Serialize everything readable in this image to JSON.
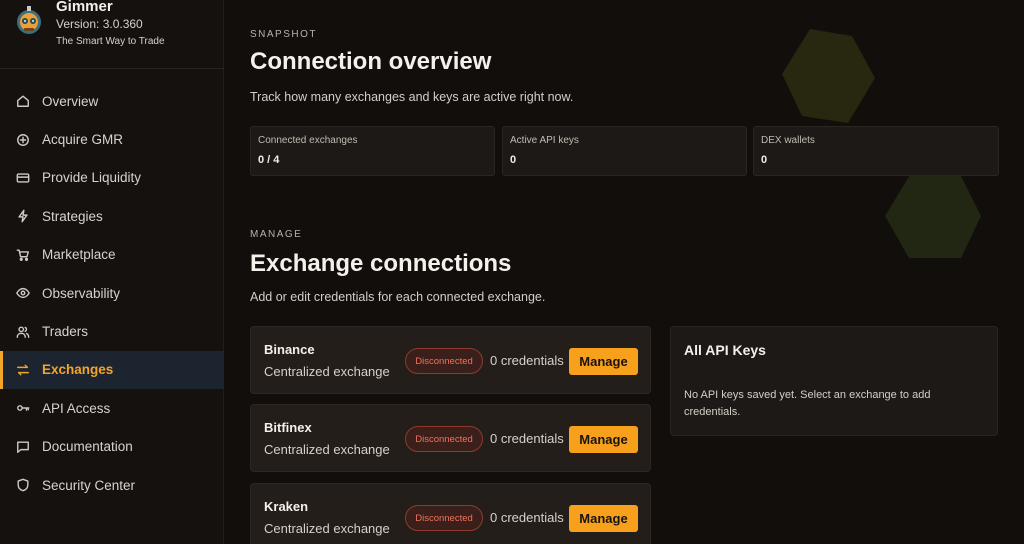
{
  "brand": {
    "name": "Gimmer",
    "version": "Version: 3.0.360",
    "tagline": "The Smart Way to Trade"
  },
  "nav": [
    {
      "label": "Overview",
      "icon": "home-icon"
    },
    {
      "label": "Acquire GMR",
      "icon": "plus-circle-icon"
    },
    {
      "label": "Provide Liquidity",
      "icon": "wallet-icon"
    },
    {
      "label": "Strategies",
      "icon": "lightning-icon"
    },
    {
      "label": "Marketplace",
      "icon": "cart-icon"
    },
    {
      "label": "Observability",
      "icon": "eye-icon"
    },
    {
      "label": "Traders",
      "icon": "users-icon"
    },
    {
      "label": "Exchanges",
      "icon": "swap-arrows-icon",
      "active": true
    },
    {
      "label": "API Access",
      "icon": "key-icon"
    },
    {
      "label": "Documentation",
      "icon": "message-square-icon"
    },
    {
      "label": "Security Center",
      "icon": "shield-icon"
    }
  ],
  "snapshot": {
    "eyebrow": "SNAPSHOT",
    "title": "Connection overview",
    "lead": "Track how many exchanges and keys are active right now.",
    "stats": [
      {
        "label": "Connected exchanges",
        "value": "0 / 4"
      },
      {
        "label": "Active API keys",
        "value": "0"
      },
      {
        "label": "DEX wallets",
        "value": "0"
      }
    ]
  },
  "manage": {
    "eyebrow": "MANAGE",
    "title": "Exchange connections",
    "lead": "Add or edit credentials for each connected exchange.",
    "exchanges": [
      {
        "name": "Binance",
        "type": "Centralized exchange",
        "status": "Disconnected",
        "credentials": "0 credentials",
        "action": "Manage"
      },
      {
        "name": "Bitfinex",
        "type": "Centralized exchange",
        "status": "Disconnected",
        "credentials": "0 credentials",
        "action": "Manage"
      },
      {
        "name": "Kraken",
        "type": "Centralized exchange",
        "status": "Disconnected",
        "credentials": "0 credentials",
        "action": "Manage"
      }
    ]
  },
  "api_keys": {
    "title": "All API Keys",
    "empty": "No API keys saved yet. Select an exchange to add credentials."
  },
  "colors": {
    "accent": "#f7a01c",
    "status_disconnected": "#f0735f"
  }
}
